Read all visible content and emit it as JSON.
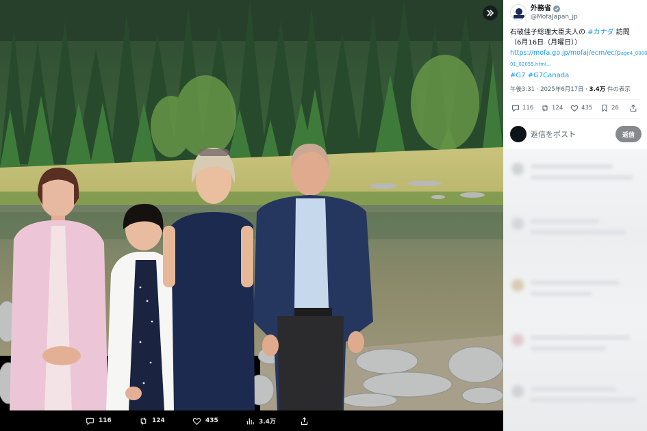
{
  "post": {
    "author_name": "外務省",
    "author_handle": "@MofaJapan_jp",
    "avatar_label": "外務省",
    "text_prefix": "石破佳子総理大臣夫人の",
    "hashtag_canada": "#カナダ",
    "text_suffix": "訪問",
    "text_line2": "（6月16日（月曜日））",
    "url_main": "https://mofa.go.jp/mofaj/ecm/ec/p",
    "url_tail": "age4_0000",
    "url_line2": "01_02055.html",
    "url_ellipsis": "…",
    "hashtag_g7": "#G7",
    "hashtag_g7canada": "#G7Canada",
    "timestamp": "午後3:31 · 2025年6月17日 · ",
    "views_count": "3.4万",
    "views_label": " 件の表示"
  },
  "panel_actions": {
    "replies": "116",
    "reposts": "124",
    "likes": "435",
    "bookmarks": "26"
  },
  "reply_box": {
    "placeholder": "返信をポスト",
    "button_label": "返信"
  },
  "viewer_bar": {
    "replies": "116",
    "reposts": "124",
    "likes": "435",
    "views": "3.4万"
  },
  "colors": {
    "accent": "#1d9bf0",
    "verified": "#829aab",
    "reply_button": "#87898c"
  },
  "icons": [
    "expand-icon",
    "verified-badge-icon",
    "reply-icon",
    "repost-icon",
    "like-icon",
    "bookmark-icon",
    "share-icon",
    "views-icon"
  ]
}
